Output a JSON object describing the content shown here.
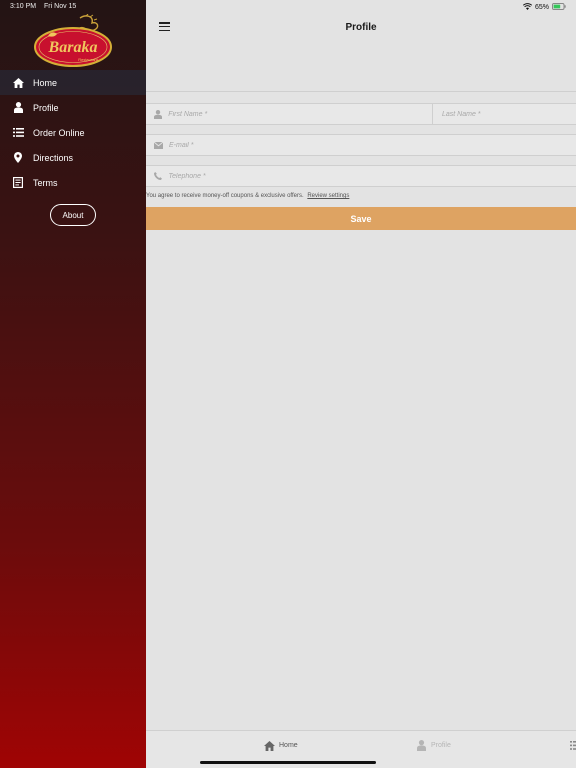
{
  "status": {
    "time": "3:10 PM",
    "date": "Fri Nov 15",
    "battery": "65%"
  },
  "brand": {
    "logo_text": "Baraka",
    "logo_subtext": "Restaurant",
    "colors": {
      "drawer_top": "#231414",
      "drawer_bottom": "#a00404",
      "accent": "#dea362"
    }
  },
  "drawer": {
    "items": [
      {
        "label": "Home",
        "icon": "home-icon"
      },
      {
        "label": "Profile",
        "icon": "person-icon"
      },
      {
        "label": "Order Online",
        "icon": "list-icon"
      },
      {
        "label": "Directions",
        "icon": "map-pin-icon"
      },
      {
        "label": "Terms",
        "icon": "document-icon"
      }
    ],
    "about_label": "About"
  },
  "header": {
    "title": "Profile",
    "menu_icon": "hamburger-icon"
  },
  "form": {
    "first_name": {
      "placeholder": "First Name *",
      "value": ""
    },
    "last_name": {
      "placeholder": "Last Name *",
      "value": ""
    },
    "email": {
      "placeholder": "E-mail *",
      "value": ""
    },
    "telephone": {
      "placeholder": "Telephone *",
      "value": ""
    },
    "consent_text": "You agree to receive money-off coupons & exclusive offers.",
    "consent_link": "Review settings",
    "save_label": "Save"
  },
  "tabbar": {
    "tabs": [
      {
        "label": "Home",
        "icon": "home-icon"
      },
      {
        "label": "Profile",
        "icon": "person-icon"
      }
    ]
  }
}
